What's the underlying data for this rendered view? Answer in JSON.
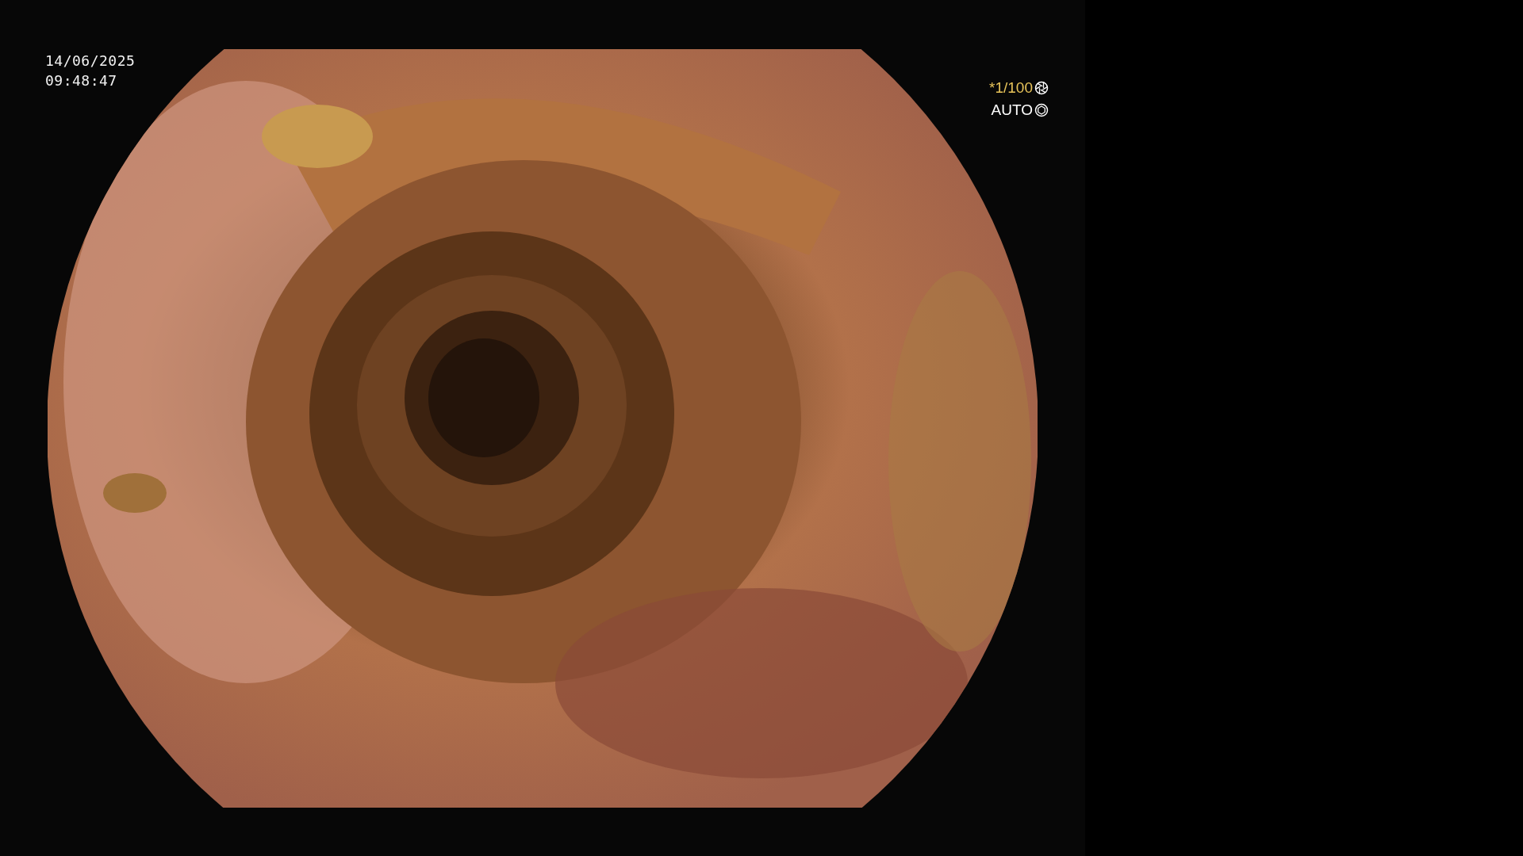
{
  "overlay": {
    "date": "14/06/2025",
    "time": "09:48:47"
  },
  "settings": [
    {
      "kind": "shutter",
      "text": "*1/100",
      "color": "#e8c45a"
    },
    {
      "kind": "iris",
      "text": "AUTO",
      "color": "#ffffff"
    }
  ]
}
